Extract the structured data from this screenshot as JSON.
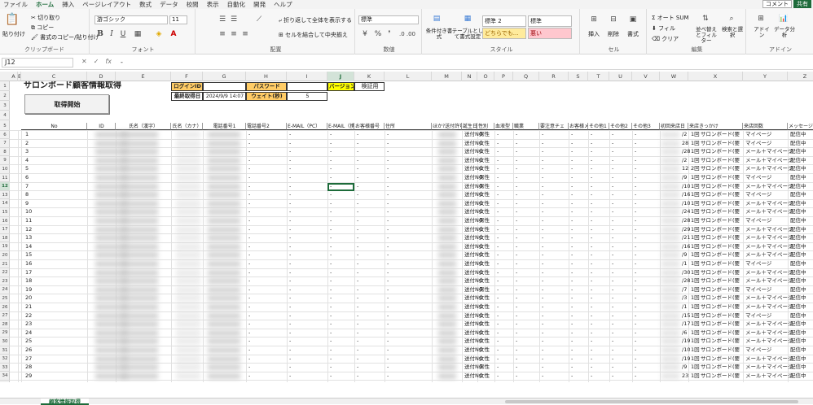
{
  "menu": {
    "tabs": [
      "ファイル",
      "ホーム",
      "挿入",
      "ページレイアウト",
      "数式",
      "データ",
      "校閲",
      "表示",
      "自動化",
      "開発",
      "ヘルプ"
    ],
    "active_index": 1,
    "comment": "コメント",
    "share": "共有"
  },
  "ribbon": {
    "clipboard": {
      "paste": "貼り付け",
      "cut": "切り取り",
      "copy": "コピー",
      "format_painter": "書式のコピー/貼り付け",
      "label": "クリップボード"
    },
    "font": {
      "name": "游ゴシック",
      "size": "11",
      "label": "フォント"
    },
    "alignment": {
      "wrap": "折り返して全体を表示する",
      "merge": "セルを結合して中央揃え",
      "label": "配置"
    },
    "number": {
      "format": "標準",
      "label": "数値"
    },
    "styles": {
      "conditional": "条件付き書式",
      "table": "テーブルとして書式設定",
      "std2": "標準 2",
      "std": "標準",
      "neutral": "どちらでも...",
      "bad": "悪い",
      "label": "スタイル"
    },
    "cells": {
      "insert": "挿入",
      "delete": "削除",
      "format": "書式",
      "label": "セル"
    },
    "editing": {
      "autosum": "オート SUM",
      "fill": "フィル",
      "clear": "クリア",
      "sort": "並べ替えとフィルター",
      "find": "検索と選択",
      "label": "編集"
    },
    "addins": {
      "addin": "アドイン",
      "analysis": "データ分析",
      "label": "アドイン"
    }
  },
  "formula": {
    "cell": "J12",
    "value": "-",
    "cancel": "✕",
    "enter": "✓",
    "fx": "fx"
  },
  "columns": [
    "A",
    "B",
    "C",
    "D",
    "E",
    "F",
    "G",
    "H",
    "I",
    "J",
    "K",
    "L",
    "M",
    "N",
    "O",
    "P",
    "Q",
    "R",
    "S",
    "T",
    "U",
    "V",
    "W",
    "X",
    "Y",
    "Z",
    "AA"
  ],
  "rows": [
    "1",
    "2",
    "3",
    "4",
    "5",
    "6",
    "7",
    "8",
    "9",
    "10",
    "11",
    "12",
    "13",
    "14",
    "15",
    "16",
    "17",
    "18",
    "19",
    "20",
    "21",
    "22",
    "23",
    "24",
    "25",
    "26",
    "27",
    "28",
    "29",
    "30",
    "31",
    "32",
    "33",
    "34"
  ],
  "sheet": {
    "title": "サロンボード顧客情報取得",
    "button": "取得開始",
    "login_label": "ログインID",
    "password_label": "パスワード",
    "version_label": "バージョン",
    "version_value": "検証用",
    "last_label": "最終取得日",
    "last_value": "2024/9/9 14:07",
    "wait_label": "ウェイト(秒)",
    "wait_value": "5",
    "headers": [
      "No",
      "ID",
      "氏名（漢字）",
      "氏名（カナ）",
      "電話番号1",
      "電話番号2",
      "E-MAIL（PC）",
      "E-MAIL（携帯）",
      "お客様番号",
      "住所",
      "ほか?送付許可",
      "誕生日",
      "性別",
      "血液型",
      "職業",
      "要注意チェ",
      "お客様メモ",
      "その他1",
      "その他2",
      "その他3",
      "初回来店日",
      "来店きっかけ",
      "来店回数",
      "メッセージ配信先",
      "HOT PEPPER"
    ],
    "rows": [
      {
        "no": "1",
        "mail": "送付NG",
        "sex": "男性",
        "visit": "1回",
        "via": "サロンボード(要",
        "msg": "マイページ",
        "hp": "配信中"
      },
      {
        "no": "2",
        "mail": "送付NG",
        "sex": "女性",
        "visit": "1回",
        "via": "サロンボード(要",
        "msg": "マイページ",
        "hp": "配信中"
      },
      {
        "no": "3",
        "mail": "送付NG",
        "sex": "女性",
        "visit": "1回",
        "via": "サロンボード(要",
        "msg": "メール＋マイページ",
        "hp": "配信中"
      },
      {
        "no": "4",
        "mail": "送付NG",
        "sex": "女性",
        "visit": "1回",
        "via": "サロンボード(要",
        "msg": "メール＋マイページ",
        "hp": "配信中"
      },
      {
        "no": "5",
        "mail": "送付NG",
        "sex": "女性",
        "visit": "2回",
        "via": "サロンボード(要",
        "msg": "メール＋マイページ",
        "hp": "配信中"
      },
      {
        "no": "6",
        "mail": "送付NG",
        "sex": "男性",
        "visit": "1回",
        "via": "サロンボード(要",
        "msg": "マイページ",
        "hp": "配信中"
      },
      {
        "no": "7",
        "mail": "送付NG",
        "sex": "男性",
        "visit": "1回",
        "via": "サロンボード(要",
        "msg": "メール＋マイページ",
        "hp": "配信中"
      },
      {
        "no": "8",
        "mail": "送付NG",
        "sex": "女性",
        "visit": "1回",
        "via": "サロンボード(要",
        "msg": "マイページ",
        "hp": "配信中"
      },
      {
        "no": "9",
        "mail": "送付NG",
        "sex": "女性",
        "visit": "1回",
        "via": "サロンボード(要",
        "msg": "メール＋マイページ",
        "hp": "配信中"
      },
      {
        "no": "10",
        "mail": "送付NG",
        "sex": "女性",
        "visit": "1回",
        "via": "サロンボード(要",
        "msg": "メール＋マイページ",
        "hp": "配信中"
      },
      {
        "no": "11",
        "mail": "送付NG",
        "sex": "男性",
        "visit": "1回",
        "via": "サロンボード(要",
        "msg": "マイページ",
        "hp": "配信中"
      },
      {
        "no": "12",
        "mail": "送付NG",
        "sex": "女性",
        "visit": "1回",
        "via": "サロンボード(要",
        "msg": "メール＋マイページ",
        "hp": "配信中"
      },
      {
        "no": "13",
        "mail": "送付NG",
        "sex": "女性",
        "visit": "1回",
        "via": "サロンボード(要",
        "msg": "メール＋マイページ",
        "hp": "配信中"
      },
      {
        "no": "14",
        "mail": "送付NG",
        "sex": "女性",
        "visit": "1回",
        "via": "サロンボード(要",
        "msg": "メール＋マイページ",
        "hp": "配信中"
      },
      {
        "no": "15",
        "mail": "送付NG",
        "sex": "女性",
        "visit": "1回",
        "via": "サロンボード(要",
        "msg": "メール＋マイページ",
        "hp": "配信中"
      },
      {
        "no": "16",
        "mail": "送付NG",
        "sex": "女性",
        "visit": "1回",
        "via": "サロンボード(要",
        "msg": "マイページ",
        "hp": "配信中"
      },
      {
        "no": "17",
        "mail": "送付NG",
        "sex": "女性",
        "visit": "1回",
        "via": "サロンボード(要",
        "msg": "メール＋マイページ",
        "hp": "配信中"
      },
      {
        "no": "18",
        "mail": "送付NG",
        "sex": "女性",
        "visit": "1回",
        "via": "サロンボード(要",
        "msg": "メール＋マイページ",
        "hp": "配信中"
      },
      {
        "no": "19",
        "mail": "送付NG",
        "sex": "男性",
        "visit": "1回",
        "via": "サロンボード(要",
        "msg": "マイページ",
        "hp": "配信中"
      },
      {
        "no": "20",
        "mail": "送付NG",
        "sex": "女性",
        "visit": "1回",
        "via": "サロンボード(要",
        "msg": "メール＋マイページ",
        "hp": "配信中"
      },
      {
        "no": "21",
        "mail": "送付NG",
        "sex": "女性",
        "visit": "1回",
        "via": "サロンボード(要",
        "msg": "メール＋マイページ",
        "hp": "配信中"
      },
      {
        "no": "22",
        "mail": "送付NG",
        "sex": "女性",
        "visit": "1回",
        "via": "サロンボード(要",
        "msg": "マイページ",
        "hp": "配信中"
      },
      {
        "no": "23",
        "mail": "送付NG",
        "sex": "女性",
        "visit": "1回",
        "via": "サロンボード(要",
        "msg": "メール＋マイページ",
        "hp": "配信中"
      },
      {
        "no": "24",
        "mail": "送付NG",
        "sex": "女性",
        "visit": "1回",
        "via": "サロンボード(要",
        "msg": "メール＋マイページ",
        "hp": "配信中"
      },
      {
        "no": "25",
        "mail": "送付NG",
        "sex": "女性",
        "visit": "1回",
        "via": "サロンボード(要",
        "msg": "メール＋マイページ",
        "hp": "配信中"
      },
      {
        "no": "26",
        "mail": "送付NG",
        "sex": "女性",
        "visit": "1回",
        "via": "サロンボード(要",
        "msg": "マイページ",
        "hp": "配信中"
      },
      {
        "no": "27",
        "mail": "送付NG",
        "sex": "女性",
        "visit": "1回",
        "via": "サロンボード(要",
        "msg": "メール＋マイページ",
        "hp": "配信中"
      },
      {
        "no": "28",
        "mail": "送付NG",
        "sex": "男性",
        "visit": "1回",
        "via": "サロンボード(要",
        "msg": "メール＋マイページ",
        "hp": "配信中"
      },
      {
        "no": "29",
        "mail": "送付NG",
        "sex": "女性",
        "visit": "1回",
        "via": "サロンボード(要",
        "msg": "メール＋マイページ",
        "hp": "配信中"
      }
    ],
    "dates": [
      "/2",
      "28",
      "/28",
      "/2",
      "12",
      "/9",
      "/10",
      "/16",
      "/10",
      "/24",
      "/28",
      "/29",
      "/21",
      "/16",
      "/9",
      "/1",
      "/30",
      "/28",
      "/7",
      "/3",
      "/1",
      "/15",
      "/17",
      "/6",
      "/19",
      "/10",
      "/19",
      "/9",
      "23"
    ],
    "placeholder": "-"
  },
  "colors": {
    "header_yellow": "#ffff00",
    "label_orange": "#ffcc66",
    "accent": "#1d6b3a"
  },
  "sheet_tab": "顧客情報取得"
}
